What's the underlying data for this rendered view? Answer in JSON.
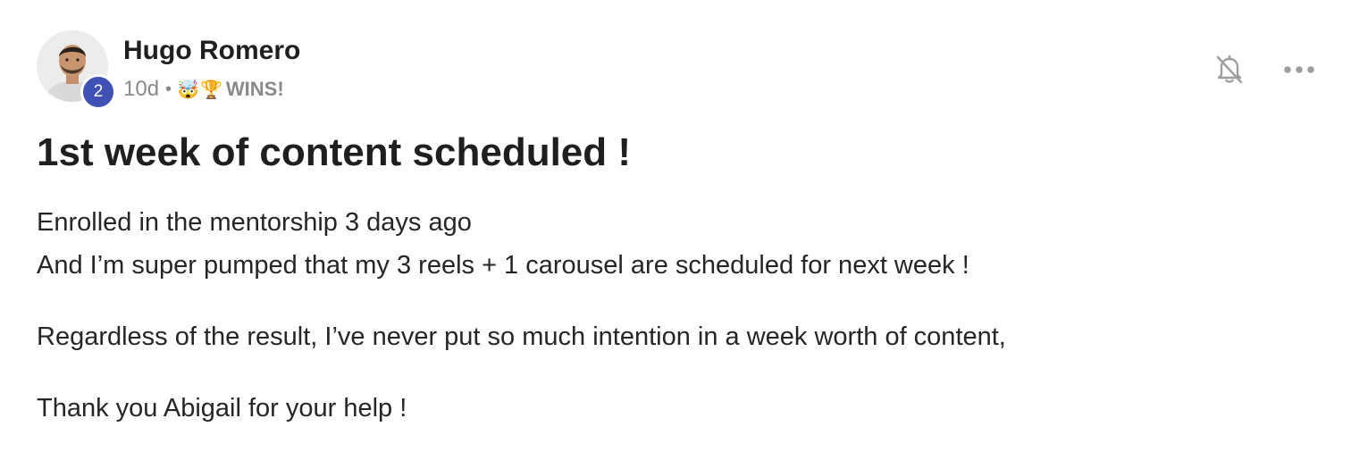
{
  "author": {
    "name": "Hugo Romero",
    "level": "2"
  },
  "meta": {
    "time_ago": "10d",
    "separator": "•",
    "category_emoji_1": "🤯",
    "category_emoji_2": "🏆",
    "category_label": "WINS!"
  },
  "post": {
    "title": "1st week of content scheduled !",
    "lines": [
      "Enrolled in the mentorship 3 days ago",
      "And I’m super pumped that my 3 reels + 1 carousel are scheduled for next week !",
      "Regardless of the result, I’ve never put so much intention in a week worth of content,",
      "Thank you Abigail for your help !"
    ]
  },
  "actions": {
    "notifications_icon": "bell-off-icon",
    "more_icon": "more-horizontal-icon"
  },
  "colors": {
    "level_badge": "#3f51b5",
    "text_primary": "#1f1f1f",
    "text_secondary": "#8a8a8a",
    "icon": "#9e9e9e"
  }
}
